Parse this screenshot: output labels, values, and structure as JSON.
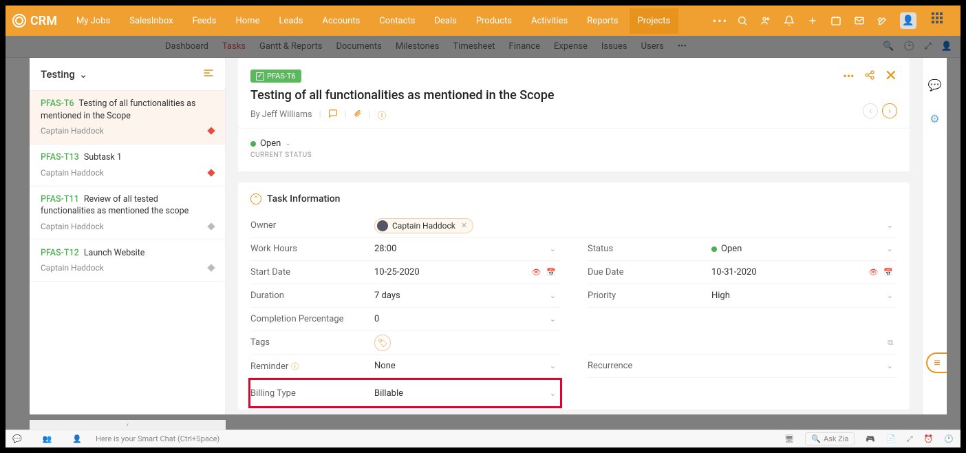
{
  "brand": "CRM",
  "nav": [
    "My Jobs",
    "SalesInbox",
    "Feeds",
    "Home",
    "Leads",
    "Accounts",
    "Contacts",
    "Deals",
    "Products",
    "Activities",
    "Reports",
    "Projects"
  ],
  "nav_active": 11,
  "subnav": [
    "Dashboard",
    "Tasks",
    "Gantt & Reports",
    "Documents",
    "Milestones",
    "Timesheet",
    "Finance",
    "Expense",
    "Issues",
    "Users"
  ],
  "subnav_active": 1,
  "side_title": "Testing",
  "tasks": [
    {
      "id": "PFAS-T6",
      "name": "Testing of all functionalities as mentioned in the Scope",
      "assignee": "Captain Haddock",
      "flag": "red",
      "sel": true
    },
    {
      "id": "PFAS-T13",
      "name": "Subtask 1",
      "assignee": "Captain Haddock",
      "flag": "red",
      "sel": false
    },
    {
      "id": "PFAS-T11",
      "name": "Review of all tested functionalities as mentioned the scope",
      "assignee": "Captain Haddock",
      "flag": "grey",
      "sel": false
    },
    {
      "id": "PFAS-T12",
      "name": "Launch Website",
      "assignee": "Captain Haddock",
      "flag": "grey",
      "sel": false
    }
  ],
  "detail": {
    "badge": "PFAS-T6",
    "title": "Testing of all functionalities as mentioned in the Scope",
    "by": "By Jeff Williams",
    "status": "Open",
    "status_lbl": "CURRENT STATUS",
    "section": "Task Information",
    "owner_lbl": "Owner",
    "owner": "Captain Haddock",
    "work_lbl": "Work Hours",
    "work": "28:00",
    "status2_lbl": "Status",
    "status2": "Open",
    "start_lbl": "Start Date",
    "start": "10-25-2020",
    "due_lbl": "Due Date",
    "due": "10-31-2020",
    "dur_lbl": "Duration",
    "dur": "7  days",
    "pri_lbl": "Priority",
    "pri": "High",
    "comp_lbl": "Completion Percentage",
    "comp": "0",
    "tags_lbl": "Tags",
    "rem_lbl": "Reminder",
    "rem": "None",
    "rec_lbl": "Recurrence",
    "bill_lbl": "Billing Type",
    "bill": "Billable"
  },
  "bottom": {
    "chat": "Here is your Smart Chat (Ctrl+Space)",
    "zia": "Ask Zia"
  }
}
